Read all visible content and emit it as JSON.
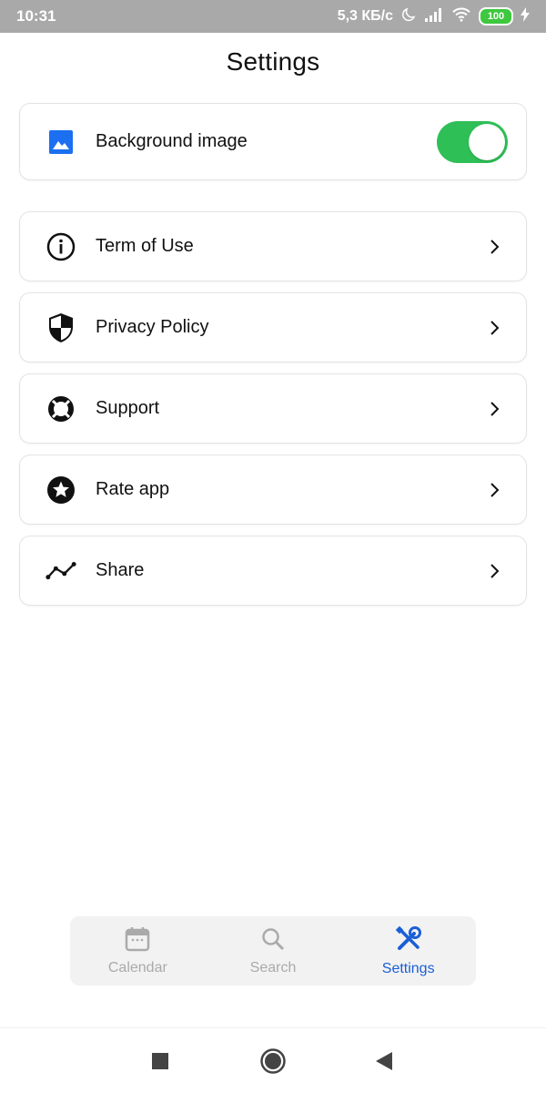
{
  "status_bar": {
    "time": "10:31",
    "speed": "5,3 КБ/с",
    "battery": "100"
  },
  "page": {
    "title": "Settings"
  },
  "settings": {
    "background": {
      "label": "Background image",
      "icon": "image-icon",
      "toggle_on": true,
      "accent": "#2fbf57"
    },
    "items": [
      {
        "label": "Term of Use",
        "icon": "info-icon"
      },
      {
        "label": "Privacy Policy",
        "icon": "shield-icon"
      },
      {
        "label": "Support",
        "icon": "lifebuoy-icon"
      },
      {
        "label": "Rate app",
        "icon": "star-icon"
      },
      {
        "label": "Share",
        "icon": "share-graph-icon"
      }
    ]
  },
  "tabbar": {
    "tabs": [
      {
        "label": "Calendar",
        "icon": "calendar-icon",
        "active": false
      },
      {
        "label": "Search",
        "icon": "search-icon",
        "active": false
      },
      {
        "label": "Settings",
        "icon": "tools-icon",
        "active": true
      }
    ],
    "active_color": "#1b5fd6",
    "inactive_color": "#aaaaaa"
  },
  "navigation": {
    "buttons": [
      "recents-button",
      "home-button",
      "back-button"
    ]
  }
}
